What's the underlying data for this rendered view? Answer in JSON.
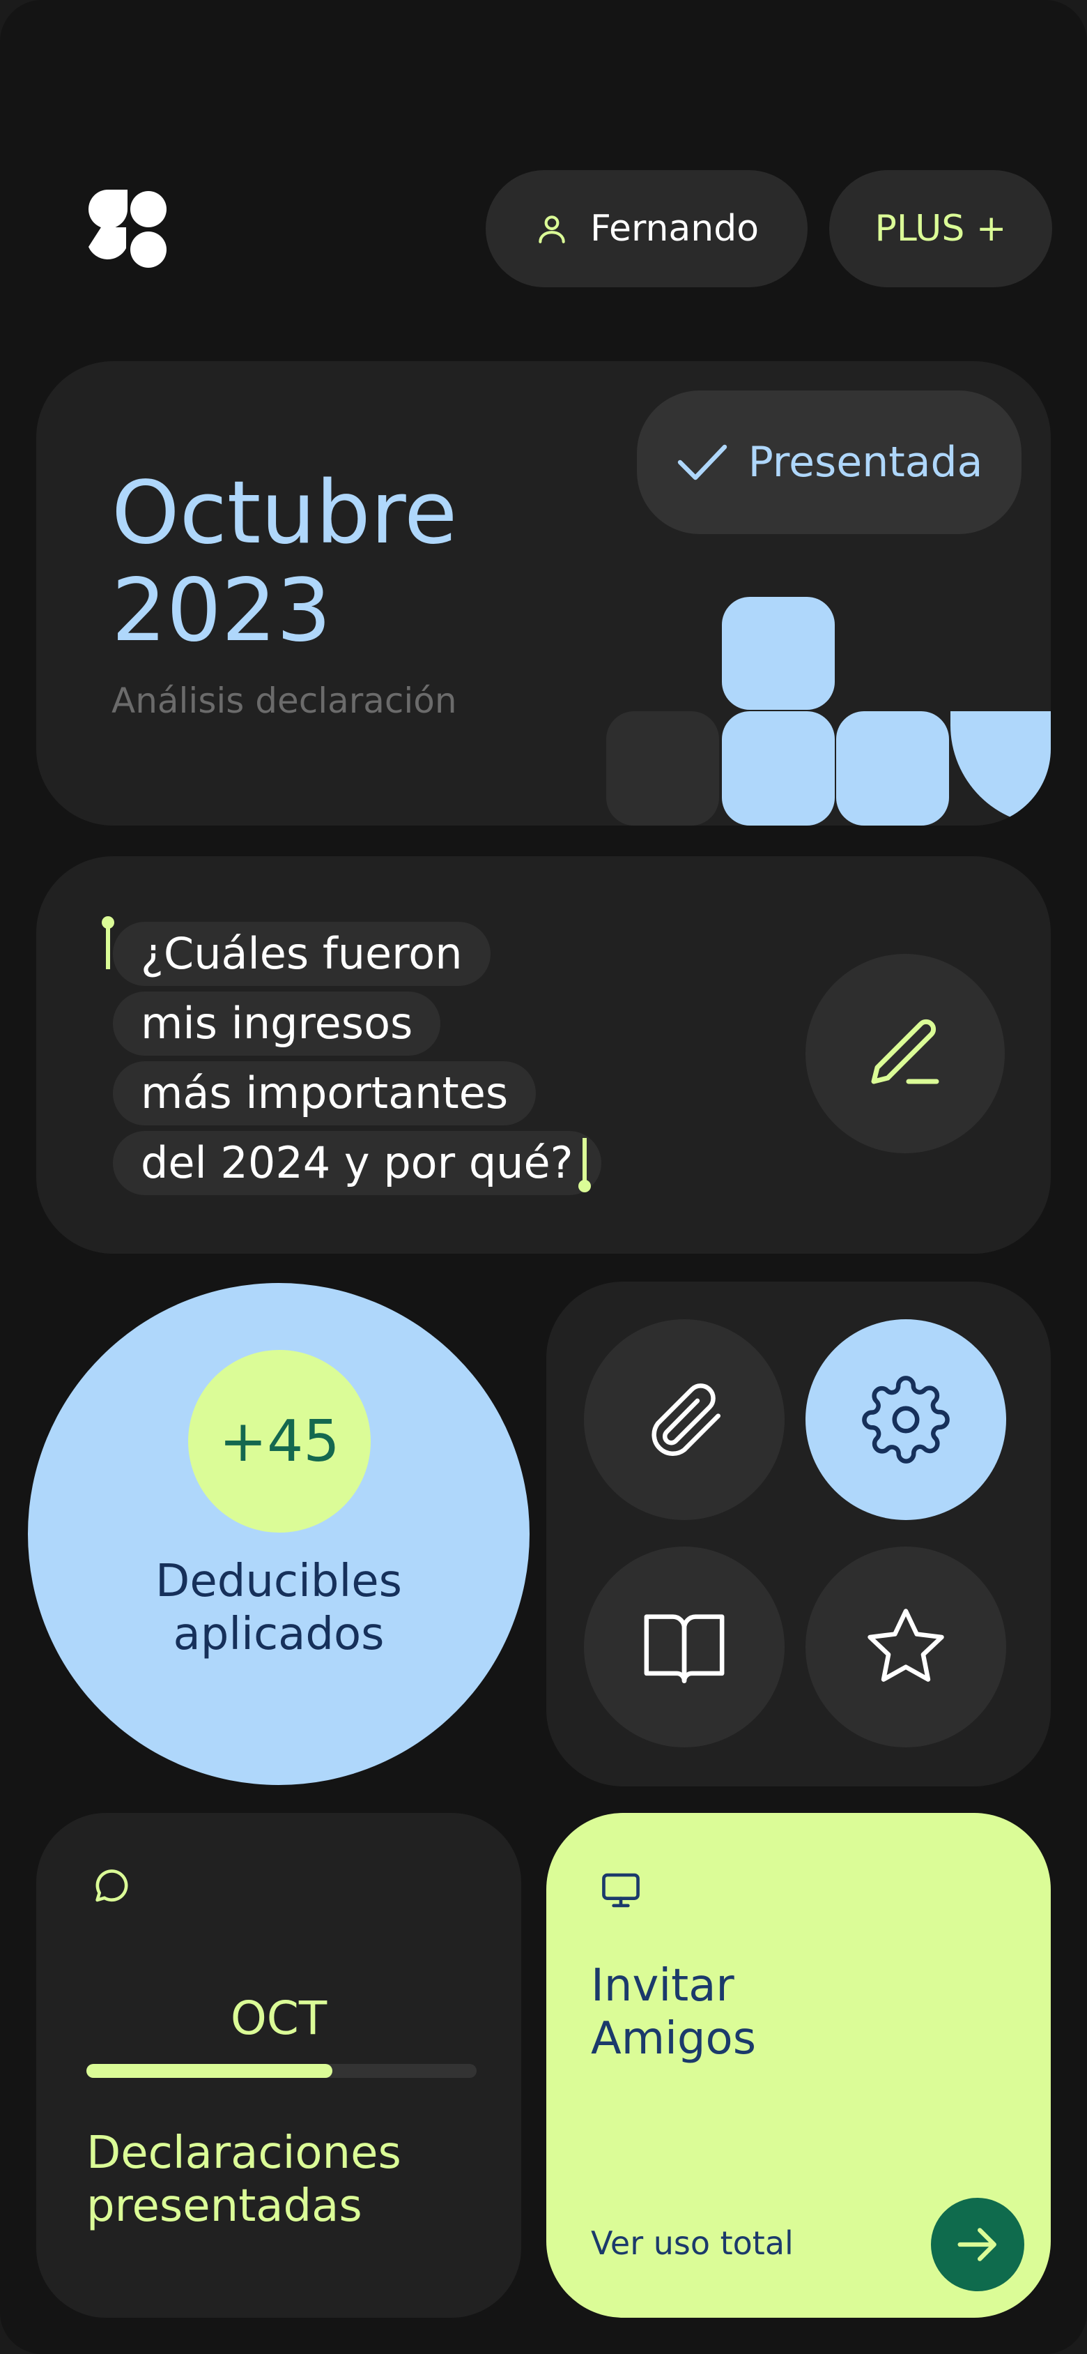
{
  "header": {
    "user_name": "Fernando",
    "plan_label": "PLUS +"
  },
  "report_card": {
    "month": "Octubre",
    "year": "2023",
    "subtitle": "Análisis declaración",
    "status": "Presentada"
  },
  "question_card": {
    "lines": [
      "¿Cuáles fueron",
      "mis ingresos",
      "más importantes",
      "del 2024 y por qué?"
    ]
  },
  "deductibles": {
    "count": "+45",
    "label_line1": "Deducibles",
    "label_line2": "aplicados"
  },
  "icon_grid": {
    "icons": [
      "paperclip-icon",
      "gear-icon",
      "book-icon",
      "star-icon"
    ],
    "active": "gear-icon"
  },
  "declarations": {
    "month": "OCT",
    "progress": 0.63,
    "label_line1": "Declaraciones",
    "label_line2": "presentadas"
  },
  "invite": {
    "title_line1": "Invitar",
    "title_line2": "Amigos",
    "link": "Ver uso total"
  },
  "colors": {
    "background": "#141414",
    "card": "#212121",
    "accent_blue": "#afd7fb",
    "accent_lime": "#dbfc97",
    "accent_green": "#0f6b4d",
    "text_navy": "#1b3a6b"
  }
}
